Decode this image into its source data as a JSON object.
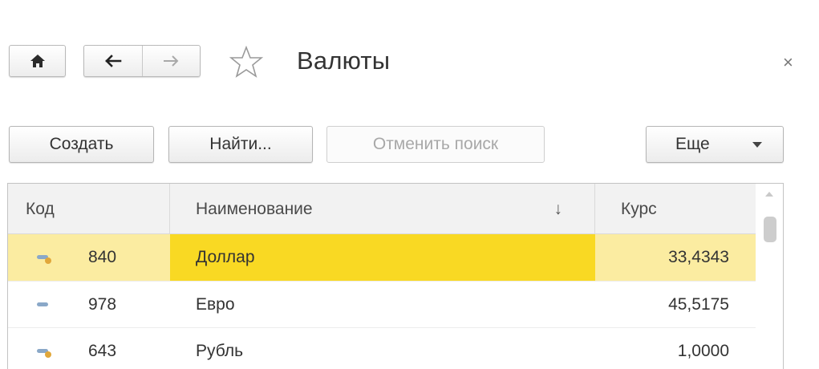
{
  "window": {
    "title": "Валюты",
    "close_glyph": "×",
    "icons": [
      "home-icon",
      "back-arrow-icon",
      "forward-arrow-icon",
      "star-icon",
      "close-icon"
    ]
  },
  "toolbar": {
    "create_label": "Создать",
    "find_label": "Найти...",
    "cancel_search_label": "Отменить поиск",
    "more_label": "Еще"
  },
  "table": {
    "columns": [
      {
        "label": "Код"
      },
      {
        "label": "Наименование",
        "sort": "↓"
      },
      {
        "label": "Курс"
      }
    ],
    "rows": [
      {
        "code": "840",
        "name": "Доллар",
        "rate": "33,4343",
        "icon": "currency-linked-icon",
        "selected": true
      },
      {
        "code": "978",
        "name": "Евро",
        "rate": "45,5175",
        "icon": "currency-icon",
        "selected": false
      },
      {
        "code": "643",
        "name": "Рубль",
        "rate": "1,0000",
        "icon": "currency-linked-icon",
        "selected": false
      }
    ]
  },
  "colors": {
    "selected_row": "#fbeca1",
    "selected_cell": "#f9d923",
    "header_bg": "#f2f2f2",
    "icon_blue": "#8aa8c8",
    "icon_gold": "#e1a73a"
  }
}
